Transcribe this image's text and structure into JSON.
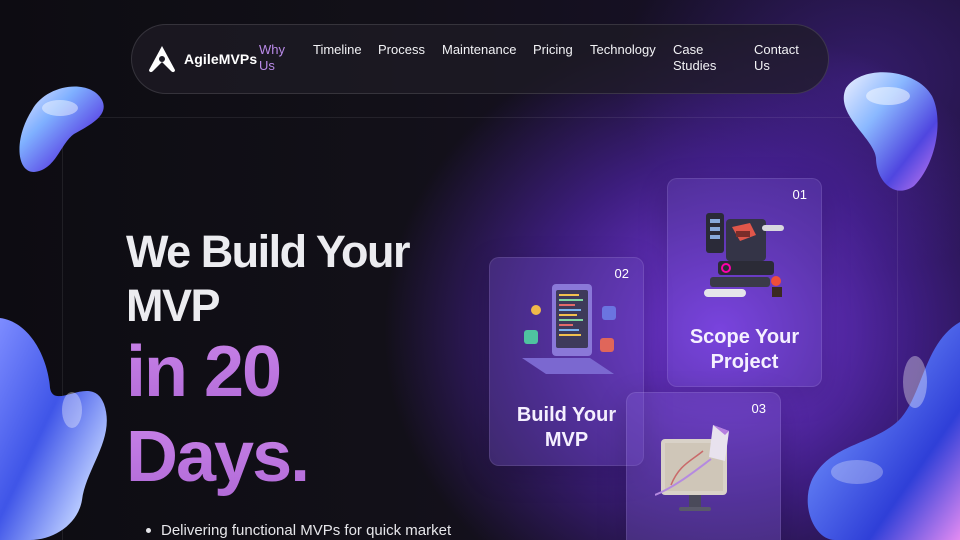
{
  "brand": {
    "name": "AgileMVPs"
  },
  "nav": {
    "items": [
      {
        "label": "Why\nUs",
        "active": true
      },
      {
        "label": "Timeline",
        "active": false
      },
      {
        "label": "Process",
        "active": false
      },
      {
        "label": "Maintenance",
        "active": false
      },
      {
        "label": "Pricing",
        "active": false
      },
      {
        "label": "Technology",
        "active": false
      },
      {
        "label": "Case\nStudies",
        "active": false
      },
      {
        "label": "Contact\nUs",
        "active": false
      }
    ]
  },
  "hero": {
    "line1": "We Build Your",
    "line2": "MVP",
    "accent1": "in 20",
    "accent2": "Days.",
    "bullets": [
      "Delivering functional MVPs for quick market"
    ]
  },
  "cards": [
    {
      "number": "01",
      "title": "Scope Your\nProject",
      "icon": "web-design-illustration-icon"
    },
    {
      "number": "02",
      "title": "Build Your\nMVP",
      "icon": "laptop-code-illustration-icon"
    },
    {
      "number": "03",
      "title": "",
      "icon": "rocket-launch-illustration-icon"
    }
  ],
  "colors": {
    "accent": "#b98ae8",
    "gradient_text": "#c882e8",
    "background": "#0b0a10",
    "purple_glow": "#803ef0"
  }
}
